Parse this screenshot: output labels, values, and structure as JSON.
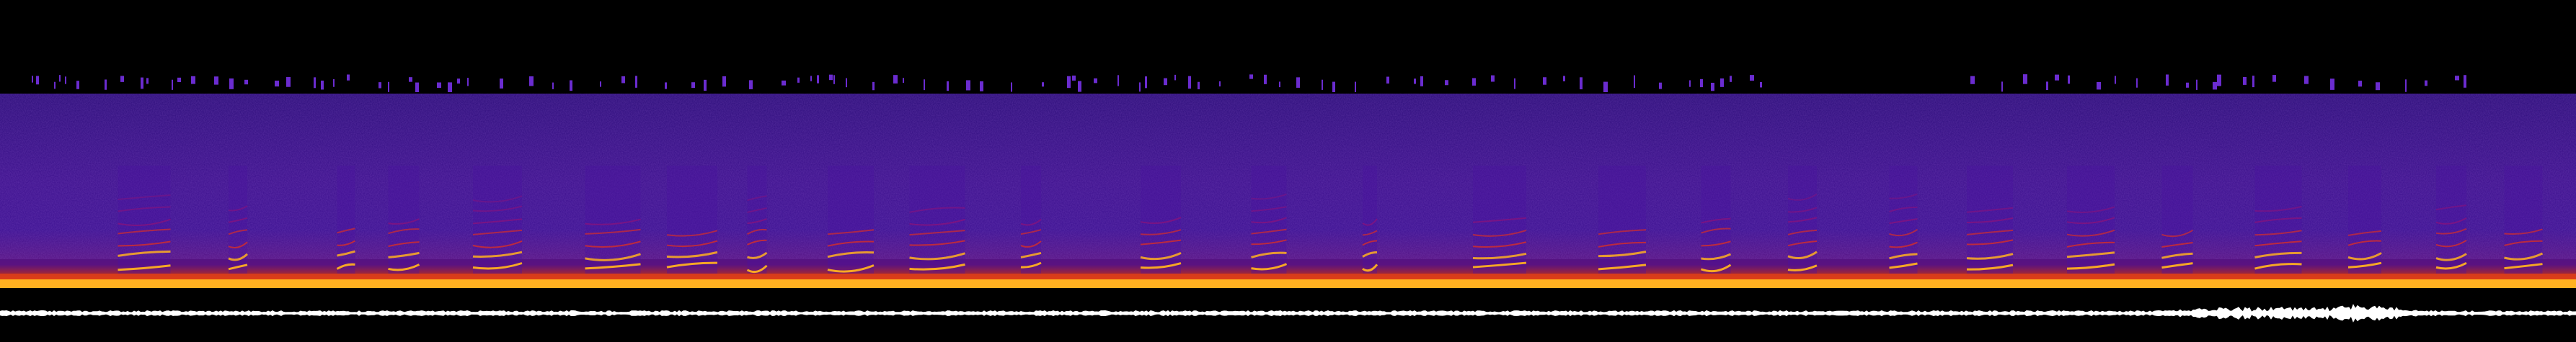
{
  "view": {
    "kind": "spectrogram-with-waveform",
    "background": "#000000",
    "palette": {
      "floor": "#2a0a6e",
      "low": "#4a12a0",
      "mid": "#a01070",
      "high": "#e03020",
      "peak": "#ffb020",
      "hot": "#fff080"
    },
    "waveform_color": "#ffffff"
  }
}
